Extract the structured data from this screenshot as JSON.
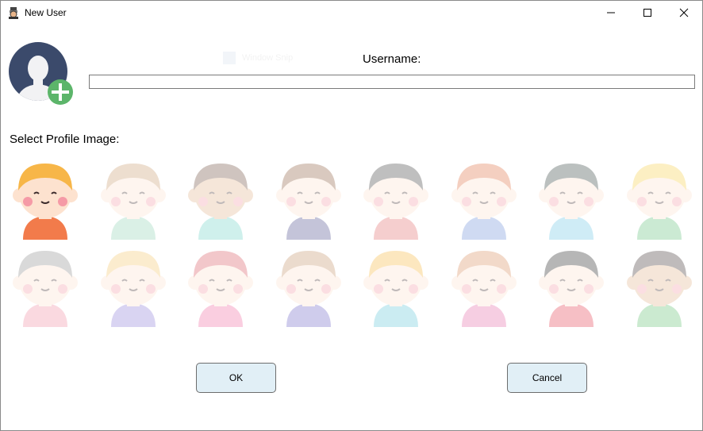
{
  "window": {
    "title": "New User",
    "controls": {
      "minimize": "minimize-icon",
      "maximize": "maximize-icon",
      "close": "close-icon"
    }
  },
  "form": {
    "username_label": "Username:",
    "username_value": "",
    "select_label": "Select Profile Image:"
  },
  "ghost_overlay": {
    "text": "Window Snip"
  },
  "profile_images": [
    {
      "name": "boy-cap",
      "skin": "#fde2cf",
      "hair": "#f7b648",
      "shirt": "#f27b4b",
      "selected": true
    },
    {
      "name": "boy-curly",
      "skin": "#fde2cf",
      "hair": "#c89c6e",
      "shirt": "#8ed1b2",
      "selected": false
    },
    {
      "name": "boy-headband",
      "skin": "#e2b48b",
      "hair": "#6b4c3b",
      "shirt": "#6ed3c6",
      "selected": false
    },
    {
      "name": "boy-scarf",
      "skin": "#fde2cf",
      "hair": "#8a5b3a",
      "shirt": "#4a4a8c",
      "selected": false
    },
    {
      "name": "boy-plaid",
      "skin": "#fde2cf",
      "hair": "#3b3b3b",
      "shirt": "#e36a6a",
      "selected": false
    },
    {
      "name": "boy-spiky",
      "skin": "#fde2cf",
      "hair": "#e06e3e",
      "shirt": "#6b8fd8",
      "selected": false
    },
    {
      "name": "grandpa",
      "skin": "#fde2cf",
      "hair": "#2f3d3b",
      "shirt": "#6dc7e6",
      "selected": false
    },
    {
      "name": "boy-tie",
      "skin": "#fde2cf",
      "hair": "#f6cf46",
      "shirt": "#5fc07a",
      "selected": false
    },
    {
      "name": "grandma",
      "skin": "#fde2cf",
      "hair": "#8a8a8a",
      "shirt": "#f08aa0",
      "selected": false
    },
    {
      "name": "girl-blonde",
      "skin": "#fde2cf",
      "hair": "#f5c66a",
      "shirt": "#8c7bd8",
      "selected": false
    },
    {
      "name": "girl-buns",
      "skin": "#fde2cf",
      "hair": "#d9535e",
      "shirt": "#f06aa0",
      "selected": false
    },
    {
      "name": "girl-long",
      "skin": "#fde2cf",
      "hair": "#c49167",
      "shirt": "#6b62c7",
      "selected": false
    },
    {
      "name": "girl-pigtails",
      "skin": "#fde2cf",
      "hair": "#f6b73c",
      "shirt": "#5fc7d8",
      "selected": false
    },
    {
      "name": "girl-flowers",
      "skin": "#fde2cf",
      "hair": "#d88a5a",
      "shirt": "#e66aa8",
      "selected": false
    },
    {
      "name": "girl-dark",
      "skin": "#fde2cf",
      "hair": "#1e1e1e",
      "shirt": "#e63a4e",
      "selected": false
    },
    {
      "name": "girl-headband",
      "skin": "#e2b48b",
      "hair": "#3b3030",
      "shirt": "#5fc070",
      "selected": false
    }
  ],
  "buttons": {
    "ok": "OK",
    "cancel": "Cancel"
  },
  "colors": {
    "button_bg": "#e1eff6",
    "add_badge": "#5cb56a",
    "avatar_bg": "#3b4a6b"
  }
}
